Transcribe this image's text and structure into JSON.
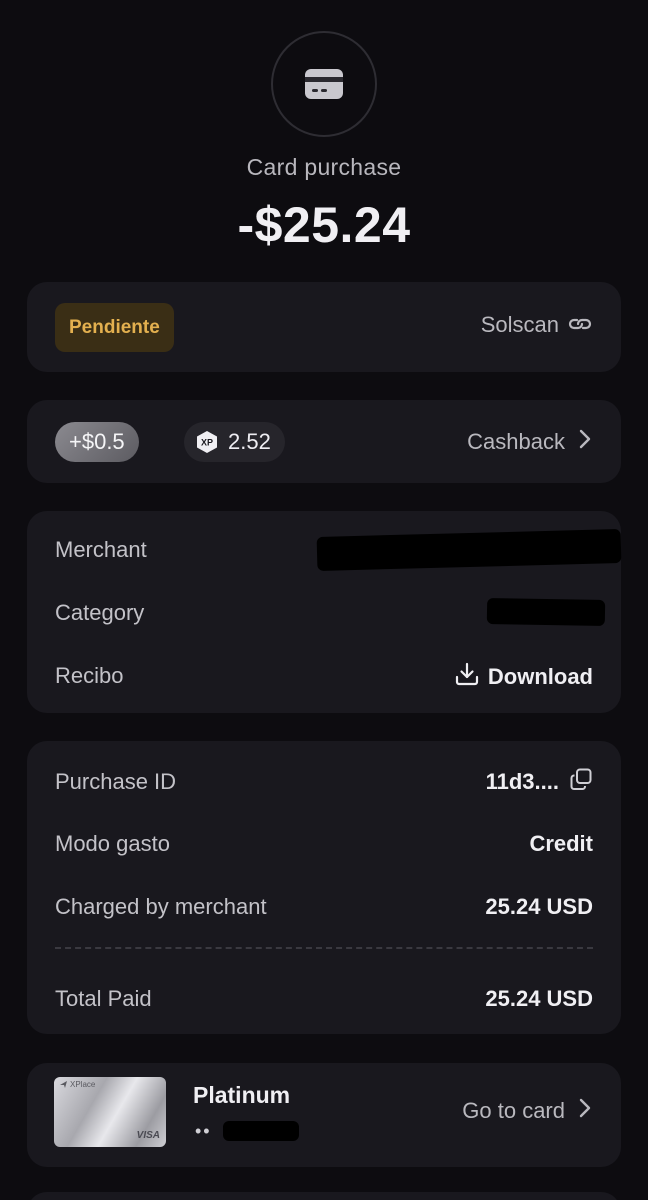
{
  "header": {
    "icon": "credit-card-icon",
    "type_label": "Card purchase",
    "amount": "-$25.24"
  },
  "status": {
    "badge": "Pendiente",
    "badge_color": "#e3b04f",
    "explorer_label": "Solscan",
    "explorer_icon": "link-icon"
  },
  "rewards": {
    "cash_amount": "+$0.5",
    "xp_icon": "xp-icon",
    "xp_value": "2.52",
    "link_label": "Cashback",
    "link_icon": "chevron-right-icon"
  },
  "details": {
    "merchant_label": "Merchant",
    "category_label": "Category",
    "receipt_label": "Recibo",
    "receipt_action": "Download",
    "receipt_icon": "download-icon"
  },
  "purchase": {
    "id_label": "Purchase ID",
    "id_value": "11d3....",
    "id_icon": "copy-icon",
    "mode_label": "Modo gasto",
    "mode_value": "Credit",
    "charged_label": "Charged by merchant",
    "charged_value": "25.24 USD",
    "total_label": "Total Paid",
    "total_value": "25.24 USD"
  },
  "card": {
    "thumb_brand": "XPlace",
    "thumb_network": "VISA",
    "name": "Platinum",
    "mask": "••",
    "link_label": "Go to card",
    "link_icon": "chevron-right-icon"
  }
}
